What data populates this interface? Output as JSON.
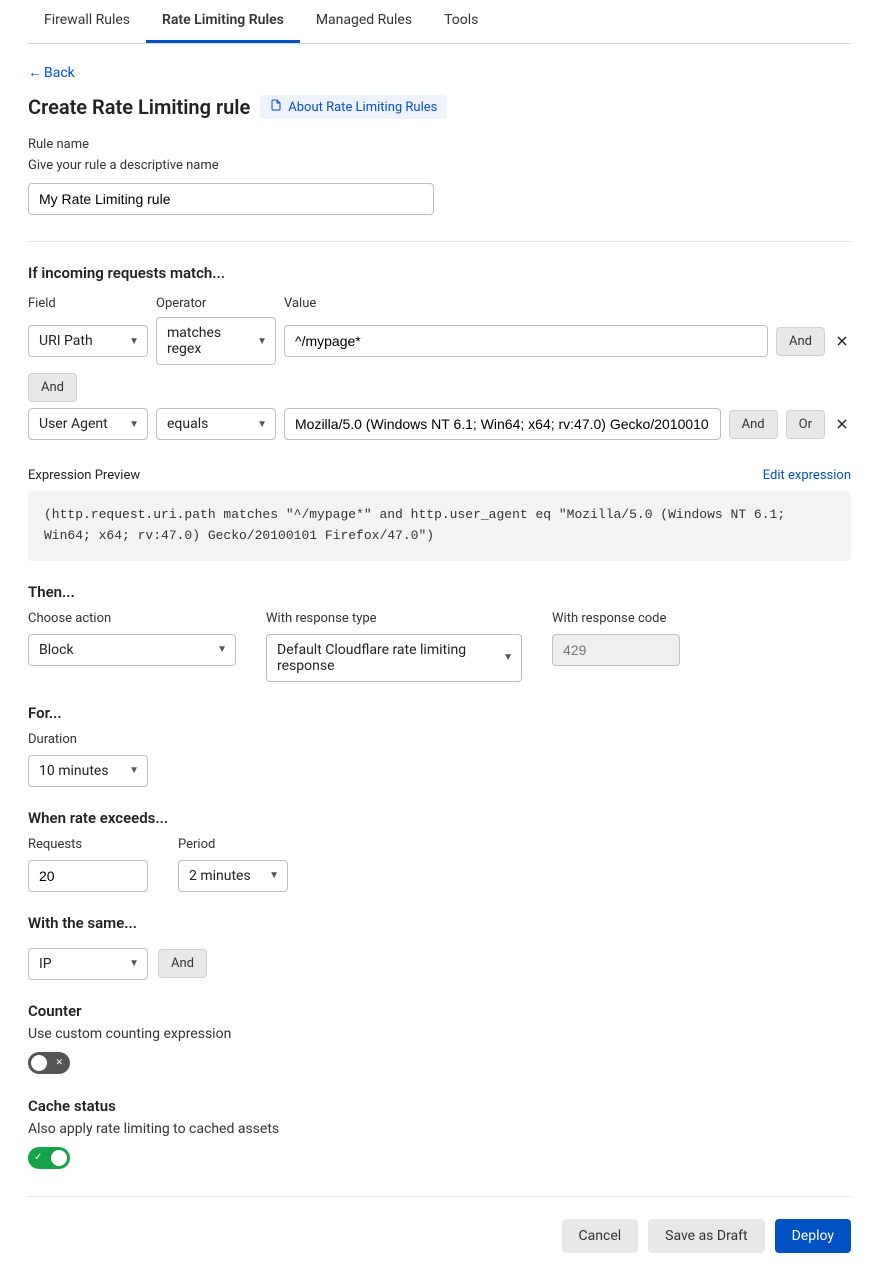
{
  "tabs": {
    "firewall": "Firewall Rules",
    "ratelimiting": "Rate Limiting Rules",
    "managed": "Managed Rules",
    "tools": "Tools"
  },
  "back": "Back",
  "page_title": "Create Rate Limiting rule",
  "about_link": "About Rate Limiting Rules",
  "rule_name": {
    "label": "Rule name",
    "help": "Give your rule a descriptive name",
    "value": "My Rate Limiting rule"
  },
  "match": {
    "title": "If incoming requests match...",
    "cols": {
      "field": "Field",
      "operator": "Operator",
      "value": "Value"
    },
    "rows": [
      {
        "field": "URI Path",
        "operator": "matches regex",
        "value": "^/mypage*",
        "tail": [
          "And"
        ]
      },
      {
        "field": "User Agent",
        "operator": "equals",
        "value": "Mozilla/5.0 (Windows NT 6.1; Win64; x64; rv:47.0) Gecko/20100101 Firefox/47.0",
        "tail": [
          "And",
          "Or"
        ]
      }
    ],
    "connector": "And"
  },
  "expression": {
    "label": "Expression Preview",
    "edit": "Edit expression",
    "text": "(http.request.uri.path matches \"^/mypage*\" and http.user_agent eq \"Mozilla/5.0 (Windows NT 6.1; Win64; x64; rv:47.0) Gecko/20100101 Firefox/47.0\")"
  },
  "then": {
    "title": "Then...",
    "action_label": "Choose action",
    "action_value": "Block",
    "response_type_label": "With response type",
    "response_type_value": "Default Cloudflare rate limiting response",
    "response_code_label": "With response code",
    "response_code_placeholder": "429"
  },
  "for": {
    "title": "For...",
    "duration_label": "Duration",
    "duration_value": "10 minutes"
  },
  "rate": {
    "title": "When rate exceeds...",
    "requests_label": "Requests",
    "requests_value": "20",
    "period_label": "Period",
    "period_value": "2 minutes"
  },
  "same": {
    "title": "With the same...",
    "value": "IP",
    "and": "And"
  },
  "counter": {
    "title": "Counter",
    "text": "Use custom counting expression"
  },
  "cache": {
    "title": "Cache status",
    "text": "Also apply rate limiting to cached assets"
  },
  "footer": {
    "cancel": "Cancel",
    "draft": "Save as Draft",
    "deploy": "Deploy"
  }
}
